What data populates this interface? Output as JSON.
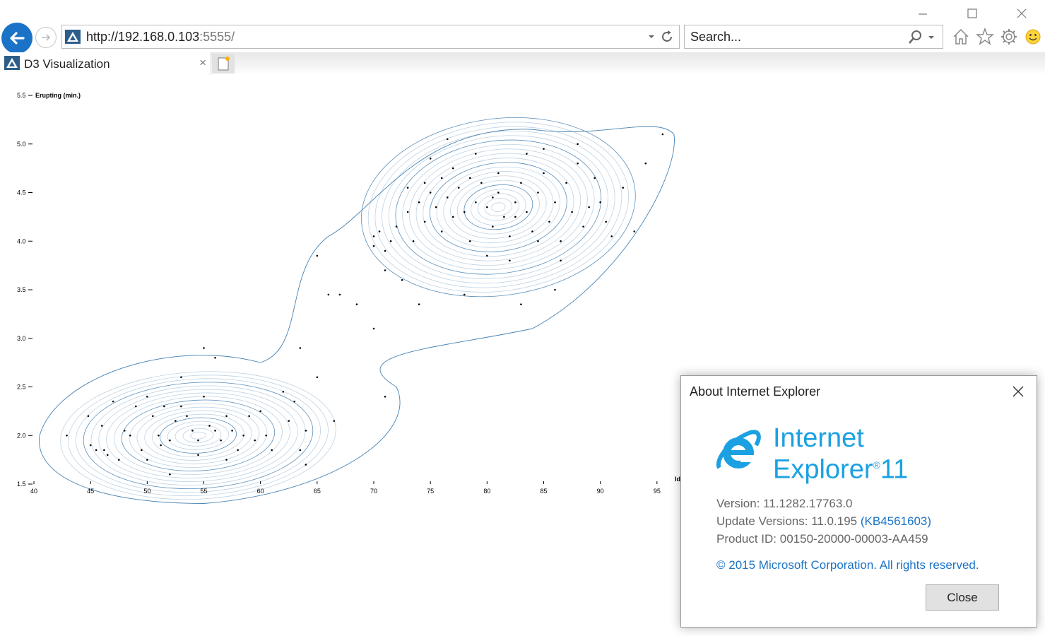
{
  "window": {
    "minimize_icon": "minimize-icon",
    "maximize_icon": "maximize-icon",
    "close_icon": "close-icon"
  },
  "nav": {
    "address_host": "http://192.168.0.103",
    "address_port": ":5555/",
    "search_placeholder": "Search..."
  },
  "tab": {
    "title": "D3 Visualization",
    "close_glyph": "×"
  },
  "chart_data": {
    "type": "scatter",
    "xlabel": "Idle (min.)",
    "ylabel": "Erupting (min.)",
    "xlim": [
      40,
      100
    ],
    "ylim": [
      1.5,
      5.5
    ],
    "x_ticks": [
      40,
      45,
      50,
      55,
      60,
      65,
      70,
      75,
      80,
      85,
      90,
      95
    ],
    "y_ticks": [
      "1.5",
      "2.0",
      "2.5",
      "3.0",
      "3.5",
      "4.0",
      "4.5",
      "5.0",
      "5.5"
    ],
    "contour_color": "#4682b4",
    "points": [
      [
        42.9,
        2.0
      ],
      [
        44.8,
        2.2
      ],
      [
        45.0,
        1.9
      ],
      [
        45.5,
        1.85
      ],
      [
        46.2,
        1.85
      ],
      [
        46.0,
        2.1
      ],
      [
        47.0,
        2.35
      ],
      [
        47.5,
        1.75
      ],
      [
        48.5,
        2.0
      ],
      [
        49.0,
        2.3
      ],
      [
        49.5,
        1.85
      ],
      [
        50.0,
        2.4
      ],
      [
        50.5,
        2.2
      ],
      [
        51.0,
        2.0
      ],
      [
        51.2,
        1.9
      ],
      [
        52.0,
        1.95
      ],
      [
        52.5,
        2.15
      ],
      [
        53.0,
        2.3
      ],
      [
        53.5,
        2.2
      ],
      [
        54.0,
        2.05
      ],
      [
        54.5,
        1.95
      ],
      [
        55.0,
        2.4
      ],
      [
        55.5,
        2.1
      ],
      [
        56.0,
        2.05
      ],
      [
        56.5,
        1.95
      ],
      [
        57.0,
        2.2
      ],
      [
        57.5,
        2.05
      ],
      [
        58.0,
        1.85
      ],
      [
        58.5,
        2.0
      ],
      [
        59.0,
        2.2
      ],
      [
        59.5,
        1.95
      ],
      [
        60.0,
        2.25
      ],
      [
        60.5,
        2.0
      ],
      [
        61.0,
        1.85
      ],
      [
        62.0,
        2.45
      ],
      [
        62.5,
        2.15
      ],
      [
        63.0,
        2.35
      ],
      [
        63.5,
        1.85
      ],
      [
        64.0,
        2.05
      ],
      [
        65.0,
        2.6
      ],
      [
        55.0,
        2.9
      ],
      [
        56.0,
        2.8
      ],
      [
        53.0,
        2.6
      ],
      [
        51.5,
        2.3
      ],
      [
        48.0,
        2.05
      ],
      [
        46.5,
        1.8
      ],
      [
        50.0,
        1.75
      ],
      [
        52.0,
        1.6
      ],
      [
        54.5,
        1.8
      ],
      [
        57.0,
        1.75
      ],
      [
        64.0,
        1.7
      ],
      [
        66.5,
        2.15
      ],
      [
        71.0,
        2.4
      ],
      [
        63.5,
        2.9
      ],
      [
        70.0,
        3.1
      ],
      [
        66.0,
        3.45
      ],
      [
        67.0,
        3.45
      ],
      [
        68.5,
        3.35
      ],
      [
        72.5,
        3.6
      ],
      [
        71.0,
        3.7
      ],
      [
        65.0,
        3.85
      ],
      [
        70.0,
        4.05
      ],
      [
        70.0,
        3.95
      ],
      [
        70.5,
        4.1
      ],
      [
        71.0,
        3.9
      ],
      [
        71.5,
        4.0
      ],
      [
        72.0,
        4.15
      ],
      [
        73.0,
        4.3
      ],
      [
        73.5,
        4.0
      ],
      [
        74.0,
        4.4
      ],
      [
        74.5,
        4.2
      ],
      [
        75.0,
        4.5
      ],
      [
        75.5,
        4.35
      ],
      [
        76.0,
        4.1
      ],
      [
        76.5,
        4.45
      ],
      [
        77.0,
        4.25
      ],
      [
        77.5,
        4.55
      ],
      [
        78.0,
        4.3
      ],
      [
        78.5,
        4.0
      ],
      [
        79.0,
        4.4
      ],
      [
        79.5,
        4.6
      ],
      [
        80.0,
        4.35
      ],
      [
        80.5,
        4.15
      ],
      [
        81.0,
        4.5
      ],
      [
        81.5,
        4.25
      ],
      [
        82.0,
        4.05
      ],
      [
        82.5,
        4.4
      ],
      [
        83.0,
        4.6
      ],
      [
        83.5,
        4.3
      ],
      [
        84.0,
        4.1
      ],
      [
        84.5,
        4.5
      ],
      [
        85.0,
        4.7
      ],
      [
        85.5,
        4.2
      ],
      [
        86.0,
        4.4
      ],
      [
        86.5,
        4.0
      ],
      [
        87.0,
        4.6
      ],
      [
        87.5,
        4.3
      ],
      [
        88.0,
        4.8
      ],
      [
        88.5,
        4.15
      ],
      [
        89.0,
        4.35
      ],
      [
        89.5,
        4.65
      ],
      [
        90.0,
        4.4
      ],
      [
        90.5,
        4.2
      ],
      [
        91.0,
        4.05
      ],
      [
        92.0,
        4.55
      ],
      [
        93.0,
        4.1
      ],
      [
        94.0,
        4.8
      ],
      [
        95.5,
        5.1
      ],
      [
        75.0,
        4.85
      ],
      [
        76.5,
        5.05
      ],
      [
        74.0,
        3.35
      ],
      [
        78.0,
        3.45
      ],
      [
        83.0,
        3.35
      ],
      [
        86.0,
        3.5
      ],
      [
        80.0,
        3.85
      ],
      [
        82.0,
        3.8
      ],
      [
        77.0,
        4.75
      ],
      [
        79.0,
        4.9
      ],
      [
        85.0,
        4.95
      ],
      [
        88.0,
        5.0
      ],
      [
        83.5,
        4.9
      ],
      [
        81.0,
        4.7
      ],
      [
        78.5,
        4.65
      ],
      [
        76.0,
        4.65
      ],
      [
        74.5,
        4.6
      ],
      [
        73.0,
        4.55
      ],
      [
        80.5,
        4.45
      ],
      [
        82.5,
        4.25
      ],
      [
        84.5,
        4.0
      ],
      [
        86.5,
        3.8
      ]
    ]
  },
  "dialog": {
    "title": "About Internet Explorer",
    "product_line1": "Internet",
    "product_line2": "Explorer",
    "product_version_num": "11",
    "version": "Version: 11.1282.17763.0",
    "update_versions_prefix": "Update Versions: 11.0.195 ",
    "update_kb": "(KB4561603)",
    "product_id": "Product ID: 00150-20000-00003-AA459",
    "copyright": "© 2015 Microsoft Corporation. All rights reserved.",
    "close_label": "Close"
  }
}
